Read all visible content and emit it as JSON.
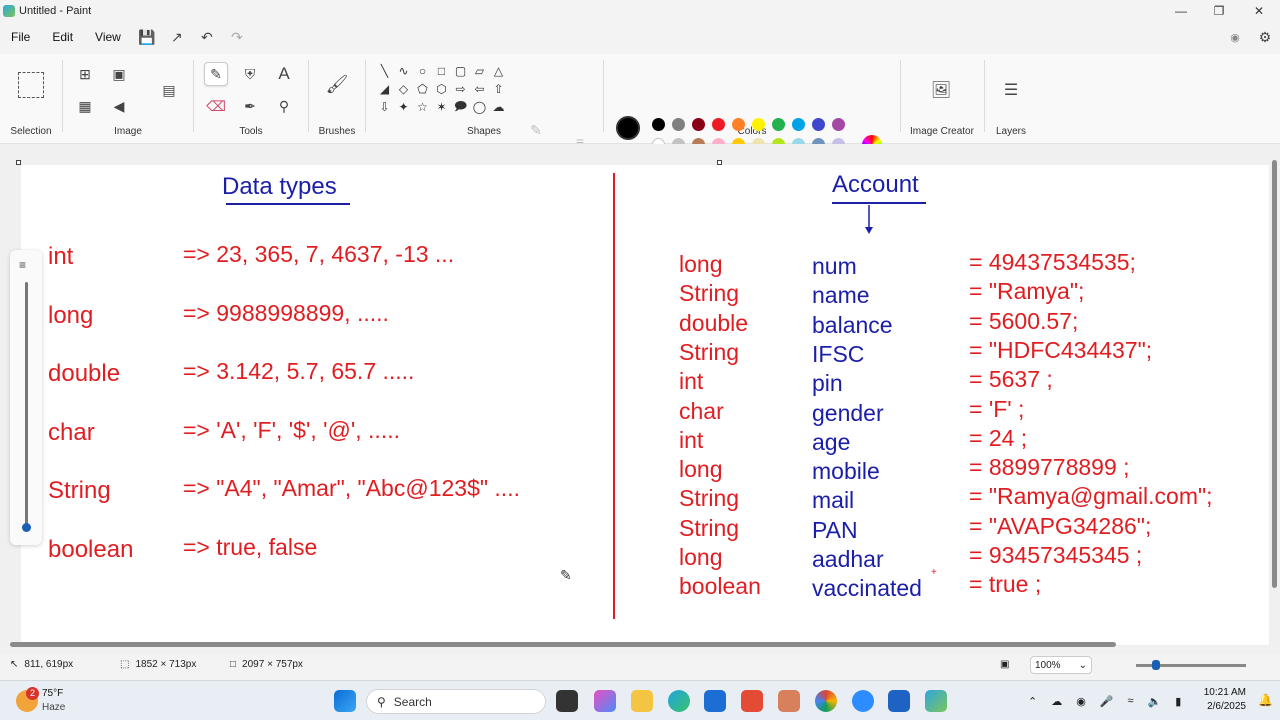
{
  "window": {
    "title": "Untitled - Paint"
  },
  "menu": [
    "File",
    "Edit",
    "View"
  ],
  "ribbon": {
    "groups": [
      "Selection",
      "Image",
      "Tools",
      "Brushes",
      "Shapes",
      "Colors",
      "Image Creator",
      "Layers"
    ],
    "colors_row1": [
      "#000000",
      "#7f7f7f",
      "#880015",
      "#ed1c24",
      "#ff7f27",
      "#fff200",
      "#22b14c",
      "#00a2e8",
      "#3f48cc",
      "#a349a4"
    ],
    "colors_row2": [
      "#ffffff",
      "#c3c3c3",
      "#b97a57",
      "#ffaec9",
      "#ffc90e",
      "#efe4b0",
      "#b5e61d",
      "#99d9ea",
      "#7092be",
      "#c8bfe7"
    ],
    "primary_color": "#000000",
    "secondary_color": "#ffffff"
  },
  "canvas": {
    "left_title": "Data types",
    "data_types": [
      {
        "type": "int",
        "value": "=>  23,  365,  7,  4637, -13 ..."
      },
      {
        "type": "long",
        "value": "=> 9988998899, ....."
      },
      {
        "type": "double",
        "value": "=> 3.142, 5.7, 65.7 ....."
      },
      {
        "type": "char",
        "value": "=> 'A', 'F', '$', '@', ....."
      },
      {
        "type": "String",
        "value": "=> \"A4\", \"Amar\", \"Abc@123$\" ...."
      },
      {
        "type": "boolean",
        "value": "=> true, false"
      }
    ],
    "right_title": "Account",
    "fields": [
      {
        "type": "long",
        "name": "num",
        "value": "= 49437534535;"
      },
      {
        "type": "String",
        "name": "name",
        "value": "= \"Ramya\";"
      },
      {
        "type": "double",
        "name": "balance",
        "value": "= 5600.57;"
      },
      {
        "type": "String",
        "name": "IFSC",
        "value": "= \"HDFC434437\";"
      },
      {
        "type": "int",
        "name": "pin",
        "value": "= 5637 ;"
      },
      {
        "type": "char",
        "name": "gender",
        "value": "= 'F' ;"
      },
      {
        "type": "int",
        "name": "age",
        "value": "= 24 ;"
      },
      {
        "type": "long",
        "name": "mobile",
        "value": "= 8899778899 ;"
      },
      {
        "type": "String",
        "name": "mail",
        "value": "= \"Ramya@gmail.com\";"
      },
      {
        "type": "String",
        "name": "PAN",
        "value": "= \"AVAPG34286\";"
      },
      {
        "type": "long",
        "name": "aadhar",
        "value": "= 93457345345 ;"
      },
      {
        "type": "boolean",
        "name": "vaccinated",
        "value": "= true ;"
      }
    ]
  },
  "status": {
    "cursor_pos": "811, 619px",
    "selection_size": "1852 × 713px",
    "canvas_size": "2097 × 757px",
    "zoom": "100%"
  },
  "taskbar": {
    "weather_temp": "75°F",
    "weather_text": "Haze",
    "weather_badge": "2",
    "search_placeholder": "Search",
    "time": "10:21 AM",
    "date": "2/6/2025"
  }
}
